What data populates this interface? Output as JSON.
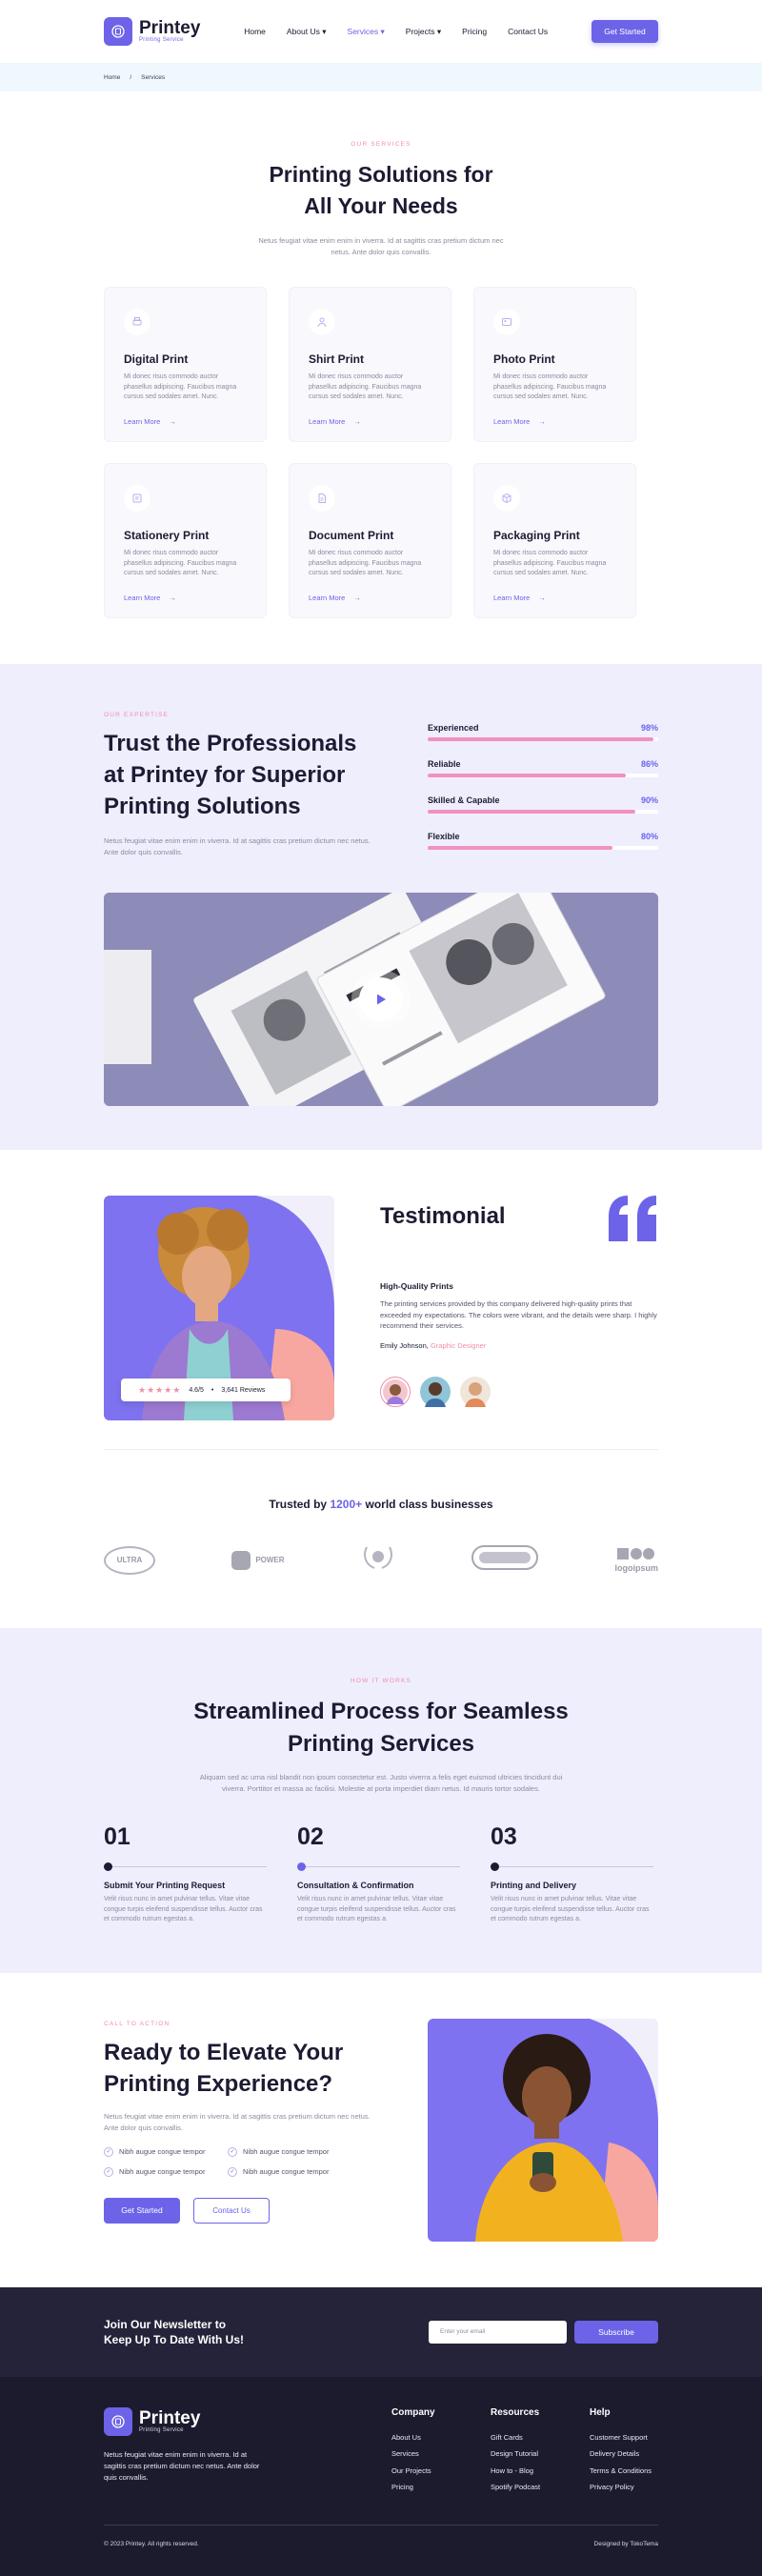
{
  "brand": {
    "name": "Printey",
    "tagline": "Printing Service"
  },
  "nav": {
    "items": [
      "Home",
      "About Us",
      "Services",
      "Projects",
      "Pricing",
      "Contact Us"
    ],
    "active": "Services",
    "cta": "Get Started"
  },
  "breadcrumb": [
    "Home",
    "/",
    "Services"
  ],
  "services": {
    "eyebrow": "OUR SERVICES",
    "title_line1": "Printing Solutions for",
    "title_line2": "All Your Needs",
    "subtitle": "Netus feugiat vitae enim enim in viverra. Id at sagittis cras pretium dictum nec netus. Ante dolor quis convallis.",
    "cards": [
      {
        "title": "Digital Print",
        "icon": "printer-icon",
        "text": "Mi donec risus commodo auctor phasellus adipiscing. Faucibus magna cursus sed sodales amet. Nunc.",
        "link": "Learn More"
      },
      {
        "title": "Shirt Print",
        "icon": "shirt-icon",
        "text": "Mi donec risus commodo auctor phasellus adipiscing. Faucibus magna cursus sed sodales amet. Nunc.",
        "link": "Learn More"
      },
      {
        "title": "Photo Print",
        "icon": "photo-icon",
        "text": "Mi donec risus commodo auctor phasellus adipiscing. Faucibus magna cursus sed sodales amet. Nunc.",
        "link": "Learn More"
      },
      {
        "title": "Stationery Print",
        "icon": "stationery-icon",
        "text": "Mi donec risus commodo auctor phasellus adipiscing. Faucibus magna cursus sed sodales amet. Nunc.",
        "link": "Learn More"
      },
      {
        "title": "Document Print",
        "icon": "document-icon",
        "text": "Mi donec risus commodo auctor phasellus adipiscing. Faucibus magna cursus sed sodales amet. Nunc.",
        "link": "Learn More"
      },
      {
        "title": "Packaging Print",
        "icon": "package-icon",
        "text": "Mi donec risus commodo auctor phasellus adipiscing. Faucibus magna cursus sed sodales amet. Nunc.",
        "link": "Learn More"
      }
    ]
  },
  "expertise": {
    "eyebrow": "OUR EXPERTISE",
    "title": "Trust the Professionals at Printey for Superior Printing Solutions",
    "text": "Netus feugiat vitae enim enim in viverra. Id at sagittis cras pretium dictum nec netus. Ante dolor quis convallis.",
    "skills": [
      {
        "label": "Experienced",
        "value": "98%",
        "fraction": 0.98
      },
      {
        "label": "Reliable",
        "value": "86%",
        "fraction": 0.86
      },
      {
        "label": "Skilled & Capable",
        "value": "90%",
        "fraction": 0.9
      },
      {
        "label": "Flexible",
        "value": "80%",
        "fraction": 0.8
      }
    ]
  },
  "testimonial": {
    "title": "Testimonial",
    "quote_title": "High-Quality Prints",
    "quote": "The printing services provided by this company delivered high-quality prints that exceeded my expectations. The colors were vibrant, and the details were sharp. I highly recommend their services.",
    "author": "Emily Johnson,",
    "role": "Graphic Designer",
    "rating": "4.6/5",
    "reviews": "3,641 Reviews",
    "stars": "★★★★★"
  },
  "trusted": {
    "prefix": "Trusted by",
    "count": "1200+",
    "suffix": "world class businesses",
    "logos": [
      "ULTRA",
      "POWER",
      "wreath-logo",
      "pill-logo",
      "logoipsum"
    ]
  },
  "process": {
    "eyebrow": "HOW IT WORKS",
    "title_line1": "Streamlined Process for Seamless",
    "title_line2": "Printing Services",
    "subtitle": "Aliquam sed ac urna nisl blandit non ipsum consectetur est. Justo viverra a felis eget euismod ultricies tincidunt dui viverra. Porttitor et massa ac facilisi. Molestie at porta imperdiet diam netus. Id mauris tortor sodales.",
    "steps": [
      {
        "num": "01",
        "title": "Submit Your Printing Request",
        "text": "Velit risus nunc in amet pulvinar tellus. Vitae vitae congue turpis eleifend suspendisse tellus. Auctor cras et commodo rutrum egestas a."
      },
      {
        "num": "02",
        "title": "Consultation & Confirmation",
        "text": "Velit risus nunc in amet pulvinar tellus. Vitae vitae congue turpis eleifend suspendisse tellus. Auctor cras et commodo rutrum egestas a."
      },
      {
        "num": "03",
        "title": "Printing and Delivery",
        "text": "Velit risus nunc in amet pulvinar tellus. Vitae vitae congue turpis eleifend suspendisse tellus. Auctor cras et commodo rutrum egestas a."
      }
    ]
  },
  "cta": {
    "eyebrow": "CALL TO ACTION",
    "title": "Ready to Elevate Your Printing Experience?",
    "text": "Netus feugiat vitae enim enim in viverra. Id at sagittis cras pretium dictum nec netus. Ante dolor quis convallis.",
    "checks": [
      "Nibh augue congue tempor",
      "Nibh augue congue tempor",
      "Nibh augue congue tempor",
      "Nibh augue congue tempor"
    ],
    "primary": "Get Started",
    "secondary": "Contact Us"
  },
  "newsletter": {
    "title_line1": "Join Our Newsletter to",
    "title_line2": "Keep Up To Date With Us!",
    "placeholder": "Enter your email",
    "button": "Subscribe"
  },
  "footer": {
    "about": "Netus feugiat vitae enim enim in viverra. Id at sagittis cras pretium dictum nec netus. Ante dolor quis convallis.",
    "columns": [
      {
        "title": "Company",
        "links": [
          "About Us",
          "Services",
          "Our Projects",
          "Pricing"
        ]
      },
      {
        "title": "Resources",
        "links": [
          "Gift Cards",
          "Design Tutorial",
          "How to - Blog",
          "Spotify Podcast"
        ]
      },
      {
        "title": "Help",
        "links": [
          "Customer Support",
          "Delivery Details",
          "Terms & Conditions",
          "Privacy Policy"
        ]
      }
    ],
    "copyright": "© 2023 Printey. All rights reserved.",
    "credit": "Designed by TokoTema"
  },
  "colors": {
    "accent": "#6c63e8",
    "pink": "#ef8fa6",
    "lavender": "#efeefd",
    "dark": "#1c1b2e"
  }
}
